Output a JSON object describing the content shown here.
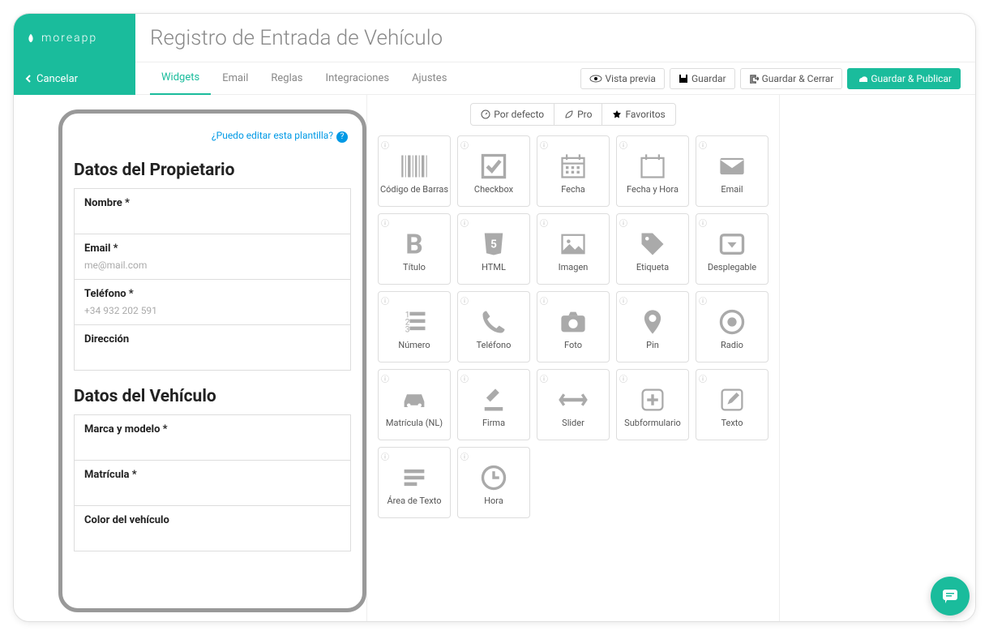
{
  "brand": "moreapp",
  "cancel": "Cancelar",
  "title": "Registro de Entrada de Vehículo",
  "tabs": [
    "Widgets",
    "Email",
    "Reglas",
    "Integraciones",
    "Ajustes"
  ],
  "actions": {
    "preview": "Vista previa",
    "save": "Guardar",
    "saveclose": "Guardar & Cerrar",
    "savepublish": "Guardar & Publicar"
  },
  "help": "¿Puedo editar esta plantilla?",
  "sections": [
    {
      "title": "Datos del Propietario",
      "fields": [
        {
          "label": "Nombre *",
          "ph": ""
        },
        {
          "label": "Email *",
          "ph": "me@mail.com"
        },
        {
          "label": "Teléfono *",
          "ph": "+34 932 202 591"
        },
        {
          "label": "Dirección",
          "ph": ""
        }
      ]
    },
    {
      "title": "Datos del Vehículo",
      "fields": [
        {
          "label": "Marca y modelo *",
          "ph": ""
        },
        {
          "label": "Matrícula *",
          "ph": ""
        },
        {
          "label": "Color del vehículo",
          "ph": ""
        }
      ]
    }
  ],
  "filters": [
    "Por defecto",
    "Pro",
    "Favoritos"
  ],
  "widgets": [
    {
      "name": "Código de Barras",
      "icon": "barcode"
    },
    {
      "name": "Checkbox",
      "icon": "check"
    },
    {
      "name": "Fecha",
      "icon": "calendar"
    },
    {
      "name": "Fecha y Hora",
      "icon": "calendar2"
    },
    {
      "name": "Email",
      "icon": "mail"
    },
    {
      "name": "Título",
      "icon": "bold"
    },
    {
      "name": "HTML",
      "icon": "html5"
    },
    {
      "name": "Imagen",
      "icon": "image"
    },
    {
      "name": "Etiqueta",
      "icon": "tag"
    },
    {
      "name": "Desplegable",
      "icon": "dropdown"
    },
    {
      "name": "Número",
      "icon": "numlist"
    },
    {
      "name": "Teléfono",
      "icon": "phone"
    },
    {
      "name": "Foto",
      "icon": "camera"
    },
    {
      "name": "Pin",
      "icon": "pin"
    },
    {
      "name": "Radio",
      "icon": "radio"
    },
    {
      "name": "Matrícula (NL)",
      "icon": "car"
    },
    {
      "name": "Firma",
      "icon": "gavel"
    },
    {
      "name": "Slider",
      "icon": "slider"
    },
    {
      "name": "Subformulario",
      "icon": "plus"
    },
    {
      "name": "Texto",
      "icon": "edit"
    },
    {
      "name": "Área de Texto",
      "icon": "textarea"
    },
    {
      "name": "Hora",
      "icon": "clock"
    }
  ]
}
